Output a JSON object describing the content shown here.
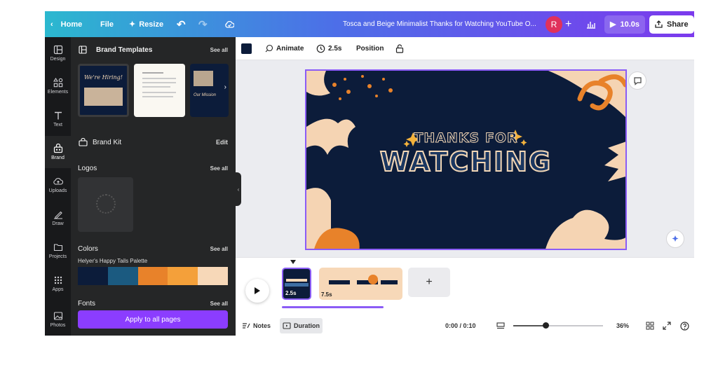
{
  "topbar": {
    "home": "Home",
    "file": "File",
    "resize": "Resize",
    "doc_title": "Tosca and Beige Minimalist Thanks for Watching YouTube O...",
    "avatar_letter": "R",
    "duration": "10.0s",
    "share": "Share"
  },
  "rail": {
    "design": "Design",
    "elements": "Elements",
    "text": "Text",
    "brand": "Brand",
    "uploads": "Uploads",
    "draw": "Draw",
    "projects": "Projects",
    "apps": "Apps",
    "photos": "Photos"
  },
  "panel": {
    "brand_templates": "Brand Templates",
    "see_all": "See all",
    "template1_text": "We're Hiring!",
    "template3_text": "Our Mission",
    "brand_kit": "Brand Kit",
    "edit": "Edit",
    "logos": "Logos",
    "colors": "Colors",
    "palette_name": "Helyer's Happy Tails Palette",
    "palette": [
      "#0c1c3a",
      "#1b5a80",
      "#e8822a",
      "#f4a03a",
      "#f7d8b8"
    ],
    "fonts": "Fonts",
    "apply_all": "Apply to all pages"
  },
  "toolbar": {
    "color": "#0c1c3a",
    "animate": "Animate",
    "duration": "2.5s",
    "position": "Position"
  },
  "slide": {
    "line1": "THANKS FOR",
    "line2": "WATCHING"
  },
  "timeline": {
    "page1_dur": "2.5s",
    "page2_dur": "7.5s",
    "add": "+",
    "notes": "Notes",
    "duration": "Duration",
    "time": "0:00 / 0:10",
    "zoom": "36%",
    "zoom_level": 0.36
  }
}
